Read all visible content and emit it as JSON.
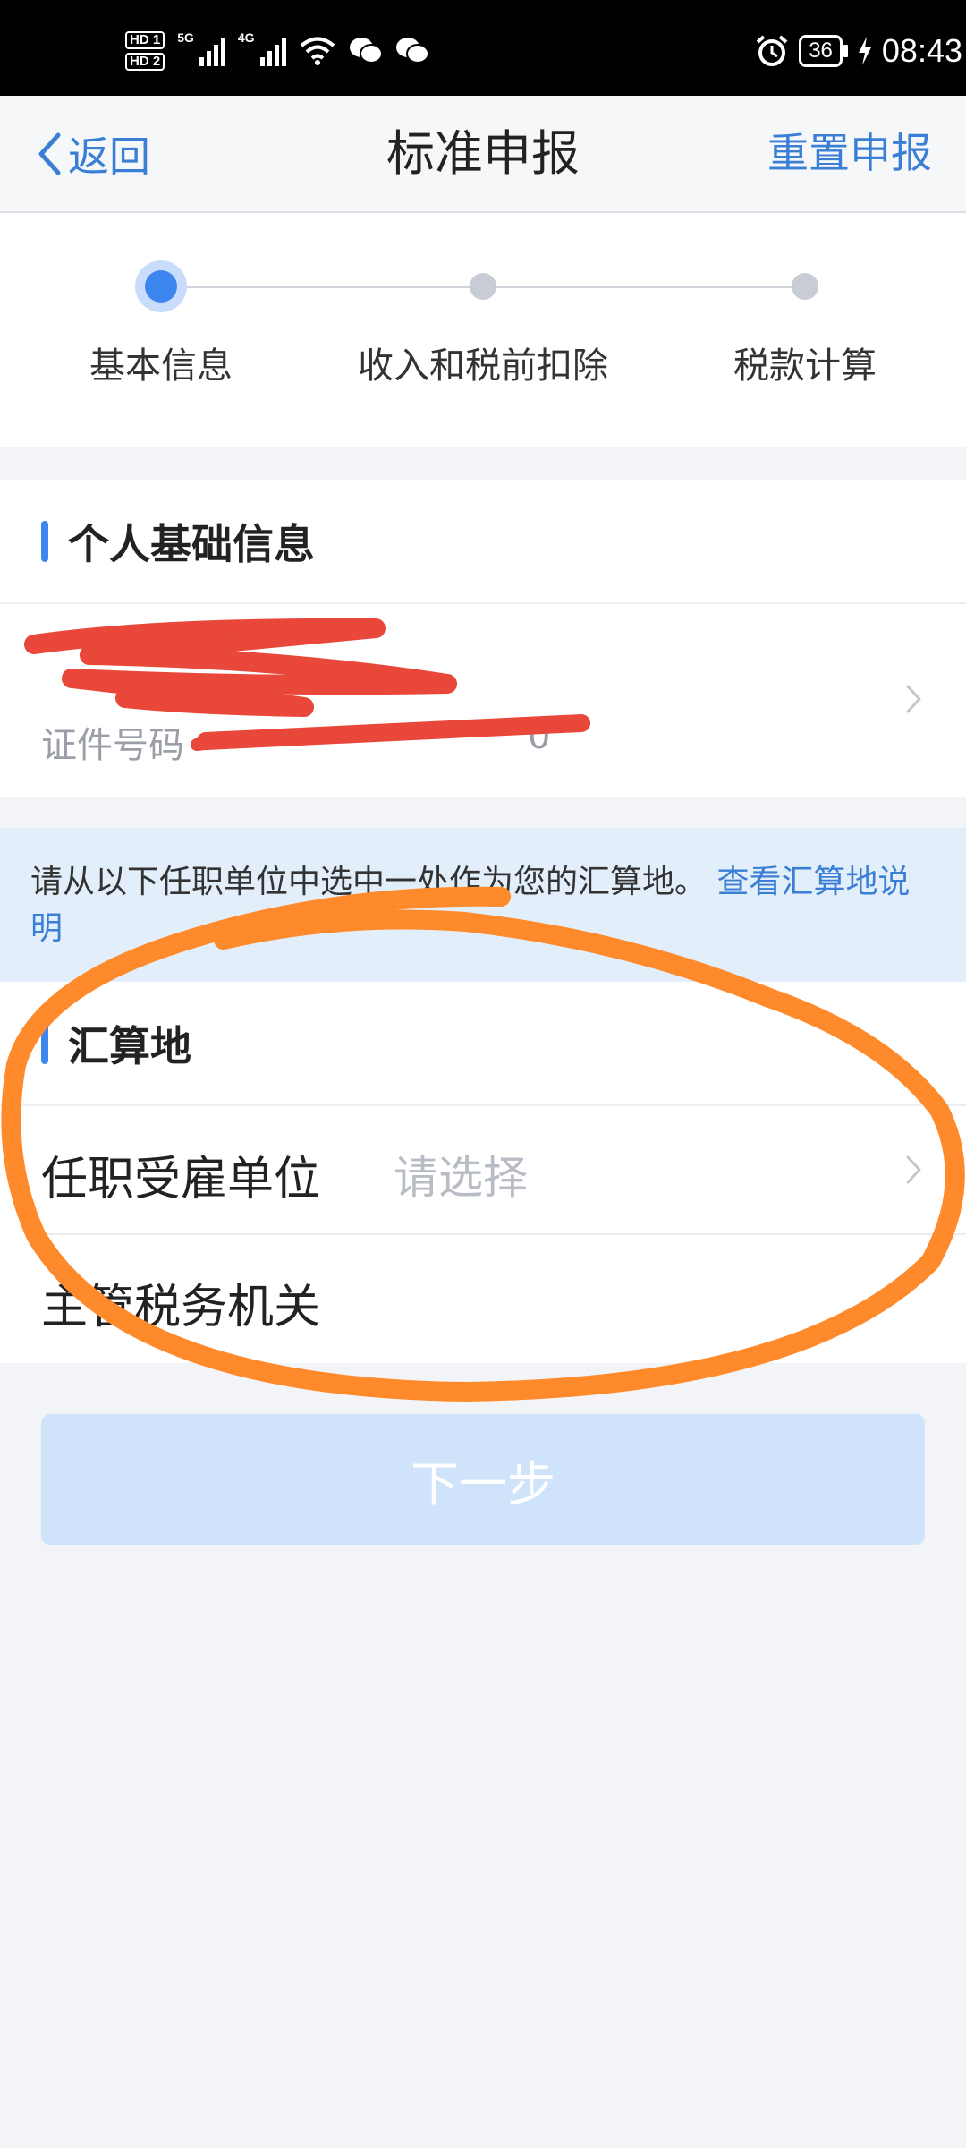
{
  "status_bar": {
    "hd1": "HD 1",
    "hd2": "HD 2",
    "net1": "5G",
    "net2": "4G",
    "battery": "36",
    "time": "08:43"
  },
  "nav": {
    "back_label": "返回",
    "title": "标准申报",
    "reset_label": "重置申报"
  },
  "stepper": {
    "active_index": 0,
    "steps": [
      "基本信息",
      "收入和税前扣除",
      "税款计算"
    ]
  },
  "personal_info": {
    "section_title": "个人基础信息",
    "id_label": "证件号码",
    "id_value_visible": "0"
  },
  "notice": {
    "text": "请从以下任职单位中选中一处作为您的汇算地。",
    "link": "查看汇算地说明"
  },
  "settlement": {
    "section_title": "汇算地",
    "employer_label": "任职受雇单位",
    "employer_placeholder": "请选择",
    "tax_authority_label": "主管税务机关"
  },
  "next_button": "下一步",
  "colors": {
    "accent": "#3d86f0",
    "link": "#3a7fd5",
    "redaction": "#e8473a",
    "annotation": "#ff8a2b",
    "button_disabled": "#cfe3fb"
  }
}
